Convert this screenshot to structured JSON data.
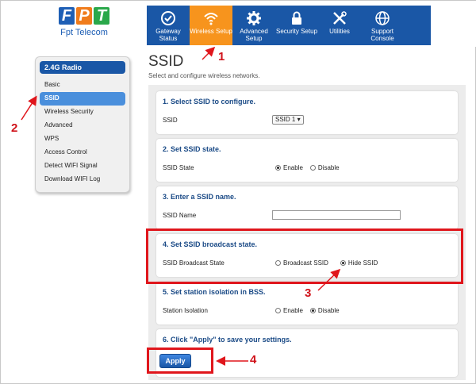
{
  "brand": {
    "logo_letters": [
      "F",
      "P",
      "T"
    ],
    "name": "Fpt Telecom"
  },
  "nav": [
    {
      "label": "Gateway Status",
      "icon": "check-circle-icon"
    },
    {
      "label": "Wireless Setup",
      "icon": "wifi-icon",
      "active": true
    },
    {
      "label": "Advanced Setup",
      "icon": "gear-icon"
    },
    {
      "label": "Security Setup",
      "icon": "lock-icon"
    },
    {
      "label": "Utilities",
      "icon": "tools-icon"
    },
    {
      "label": "Support Console",
      "icon": "globe-icon"
    }
  ],
  "sidebar": {
    "header": "2.4G Radio",
    "items": [
      "Basic",
      "SSID",
      "Wireless Security",
      "Advanced",
      "WPS",
      "Access Control",
      "Detect WIFI Signal",
      "Download WIFI Log"
    ],
    "active_index": 1
  },
  "page": {
    "title": "SSID",
    "subtitle": "Select and configure wireless networks."
  },
  "sections": {
    "s1": {
      "title": "1. Select SSID to configure.",
      "label": "SSID",
      "value": "SSID 1 ▾"
    },
    "s2": {
      "title": "2. Set SSID state.",
      "label": "SSID State",
      "opt1": "Enable",
      "opt2": "Disable",
      "selected": "Enable"
    },
    "s3": {
      "title": "3. Enter a SSID name.",
      "label": "SSID Name",
      "value": ""
    },
    "s4": {
      "title": "4. Set SSID broadcast state.",
      "label": "SSID Broadcast State",
      "opt1": "Broadcast SSID",
      "opt2": "Hide SSID",
      "selected": "Hide SSID"
    },
    "s5": {
      "title": "5. Set station isolation in BSS.",
      "label": "Station Isolation",
      "opt1": "Enable",
      "opt2": "Disable",
      "selected": "Disable"
    },
    "s6": {
      "title": "6. Click \"Apply\" to save your settings.",
      "button": "Apply"
    }
  },
  "annotations": {
    "n1": "1",
    "n2": "2",
    "n3": "3",
    "n4": "4",
    "color": "#e0161c"
  },
  "colors": {
    "nav_bg": "#1a57a6",
    "nav_active": "#f7941d",
    "section_title": "#1a4a86"
  }
}
